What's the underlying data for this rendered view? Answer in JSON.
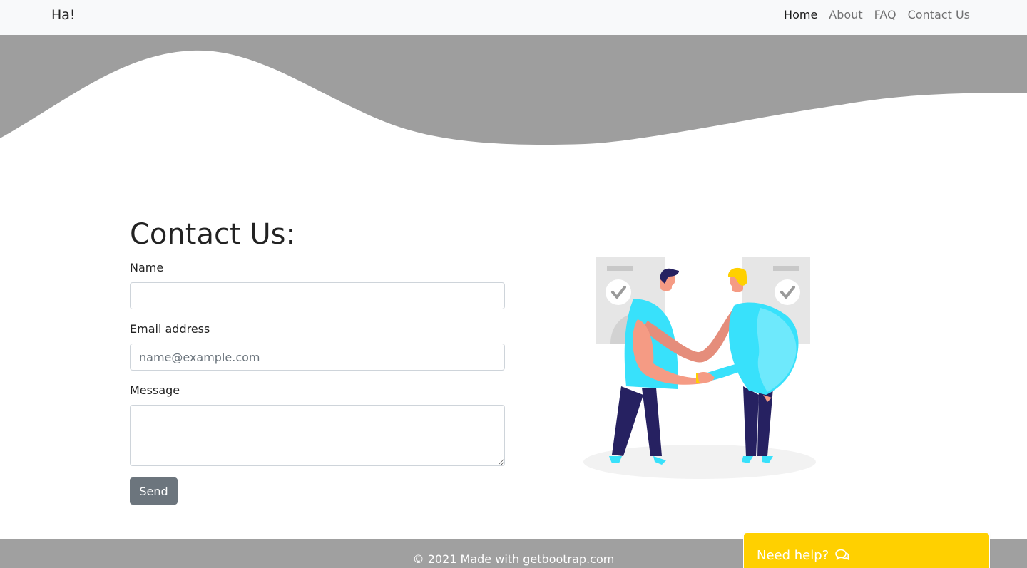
{
  "navbar": {
    "brand": "Ha!",
    "links": [
      {
        "label": "Home",
        "active": true
      },
      {
        "label": "About",
        "active": false
      },
      {
        "label": "FAQ",
        "active": false
      },
      {
        "label": "Contact Us",
        "active": false
      }
    ]
  },
  "contact": {
    "title": "Contact Us:",
    "name_label": "Name",
    "name_value": "",
    "email_label": "Email address",
    "email_placeholder": "name@example.com",
    "message_label": "Message",
    "message_value": "",
    "send_label": "Send"
  },
  "illustration": {
    "icon": "handshake-illustration"
  },
  "footer": {
    "text": "© 2021 Made with getbootrap.com"
  },
  "help_widget": {
    "label": "Need help?",
    "icon": "chat-bubbles-icon"
  },
  "colors": {
    "navbar_bg": "#f8f9fa",
    "hero_gray": "#9e9e9e",
    "button_gray": "#6c757d",
    "footer_gray": "#a0a0a0",
    "help_yellow": "#ffd000",
    "figure_cyan": "#38e1fb",
    "figure_navy": "#262161"
  }
}
